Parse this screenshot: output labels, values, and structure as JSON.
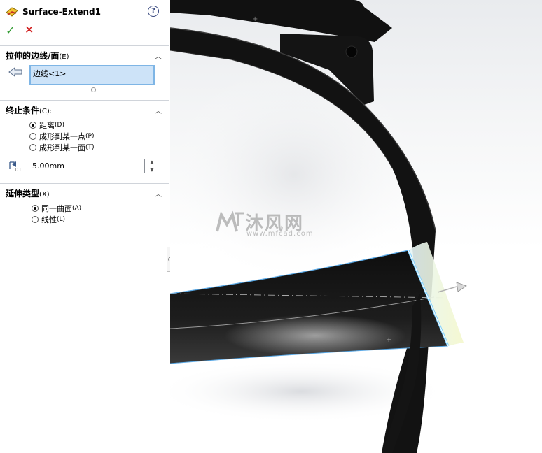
{
  "feature": {
    "title": "Surface-Extend1"
  },
  "actions": {
    "ok_label": "✓",
    "cancel_label": "✕",
    "help_label": "?"
  },
  "groups": {
    "edges": {
      "title": "拉伸的边线/面",
      "accel": "(E)",
      "selection": "边线<1>"
    },
    "end_condition": {
      "title": "终止条件",
      "accel": "(C):",
      "options": [
        {
          "label": "距离",
          "accel": "(D)",
          "selected": true
        },
        {
          "label": "成形到某一点",
          "accel": "(P)",
          "selected": false
        },
        {
          "label": "成形到某一面",
          "accel": "(T)",
          "selected": false
        }
      ],
      "distance_value": "5.00mm",
      "distance_icon_label": "D1"
    },
    "extension_type": {
      "title": "延伸类型",
      "accel": "(X)",
      "options": [
        {
          "label": "同一曲面",
          "accel": "(A)",
          "selected": true
        },
        {
          "label": "线性",
          "accel": "(L)",
          "selected": false
        }
      ]
    }
  },
  "watermark": {
    "text": "沐风网",
    "url": "www.mfcad.com"
  },
  "colors": {
    "accent_selection": "#cde3f8",
    "ok": "#2e9a2e",
    "cancel": "#d01818",
    "model": "#141414"
  }
}
